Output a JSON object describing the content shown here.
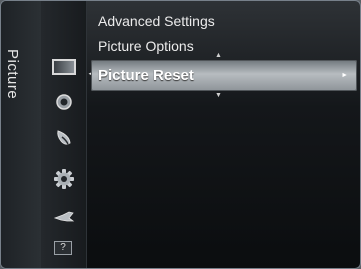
{
  "category": {
    "label": "Picture"
  },
  "icons": [
    {
      "name": "picture-icon"
    },
    {
      "name": "sound-icon"
    },
    {
      "name": "channel-icon"
    },
    {
      "name": "setup-icon"
    },
    {
      "name": "input-icon"
    },
    {
      "name": "support-icon",
      "glyph": "?"
    }
  ],
  "menu": {
    "items": [
      {
        "label": "Advanced Settings"
      },
      {
        "label": "Picture Options"
      }
    ],
    "selected": {
      "label": "Picture Reset",
      "arrow": "►"
    },
    "left_arrow": "◄",
    "up_arrow": "▲",
    "down_arrow": "▼"
  }
}
